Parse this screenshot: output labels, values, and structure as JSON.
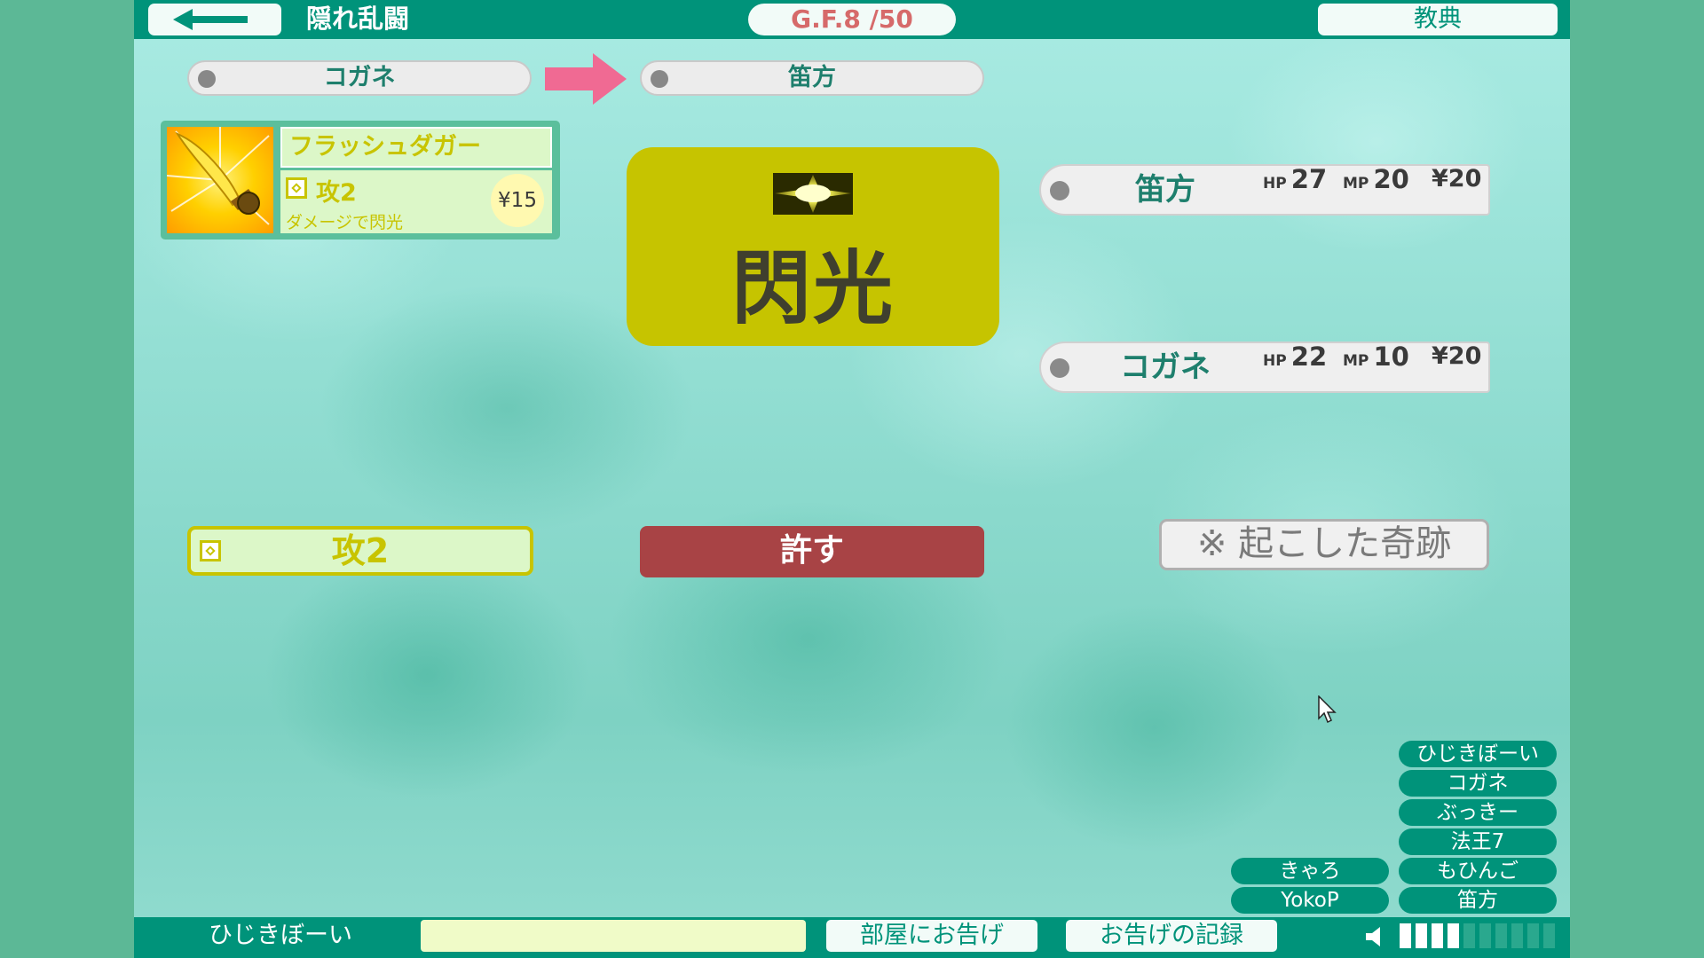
{
  "header": {
    "room_title": "隠れ乱闘",
    "gf_counter": "G.F.8 /50",
    "kyoten_label": "教典"
  },
  "attack": {
    "from_player": "コガネ",
    "to_player": "笛方"
  },
  "card": {
    "name": "フラッシュダガー",
    "attack_label": "攻2",
    "description": "ダメージで閃光",
    "price": "¥15"
  },
  "effect": {
    "word": "閃光",
    "icon": "flash-burst-icon"
  },
  "status": [
    {
      "name": "笛方",
      "hp_label": "HP",
      "hp": "27",
      "mp_label": "MP",
      "mp": "20",
      "yen": "¥20"
    },
    {
      "name": "コガネ",
      "hp_label": "HP",
      "hp": "22",
      "mp_label": "MP",
      "mp": "10",
      "yen": "¥20"
    }
  ],
  "actions": {
    "attack_value": "攻2",
    "forgive_label": "許す",
    "miracle_label": "※ 起こした奇跡"
  },
  "members": {
    "right_column": [
      "ひじきぼーい",
      "コガネ",
      "ぶっきー",
      "法王7",
      "もひんご",
      "笛方"
    ],
    "left_column": [
      "きゃろ",
      "YokoP"
    ]
  },
  "footer": {
    "self_name": "ひじきぼーい",
    "message_value": "",
    "announce_label": "部屋にお告げ",
    "log_label": "お告げの記録",
    "volume_level": 0.4,
    "volume_segments": 10
  },
  "colors": {
    "primary": "#00937a",
    "accent_yellow": "#c6c400",
    "danger": "#a84345",
    "arrow": "#f06a93"
  }
}
